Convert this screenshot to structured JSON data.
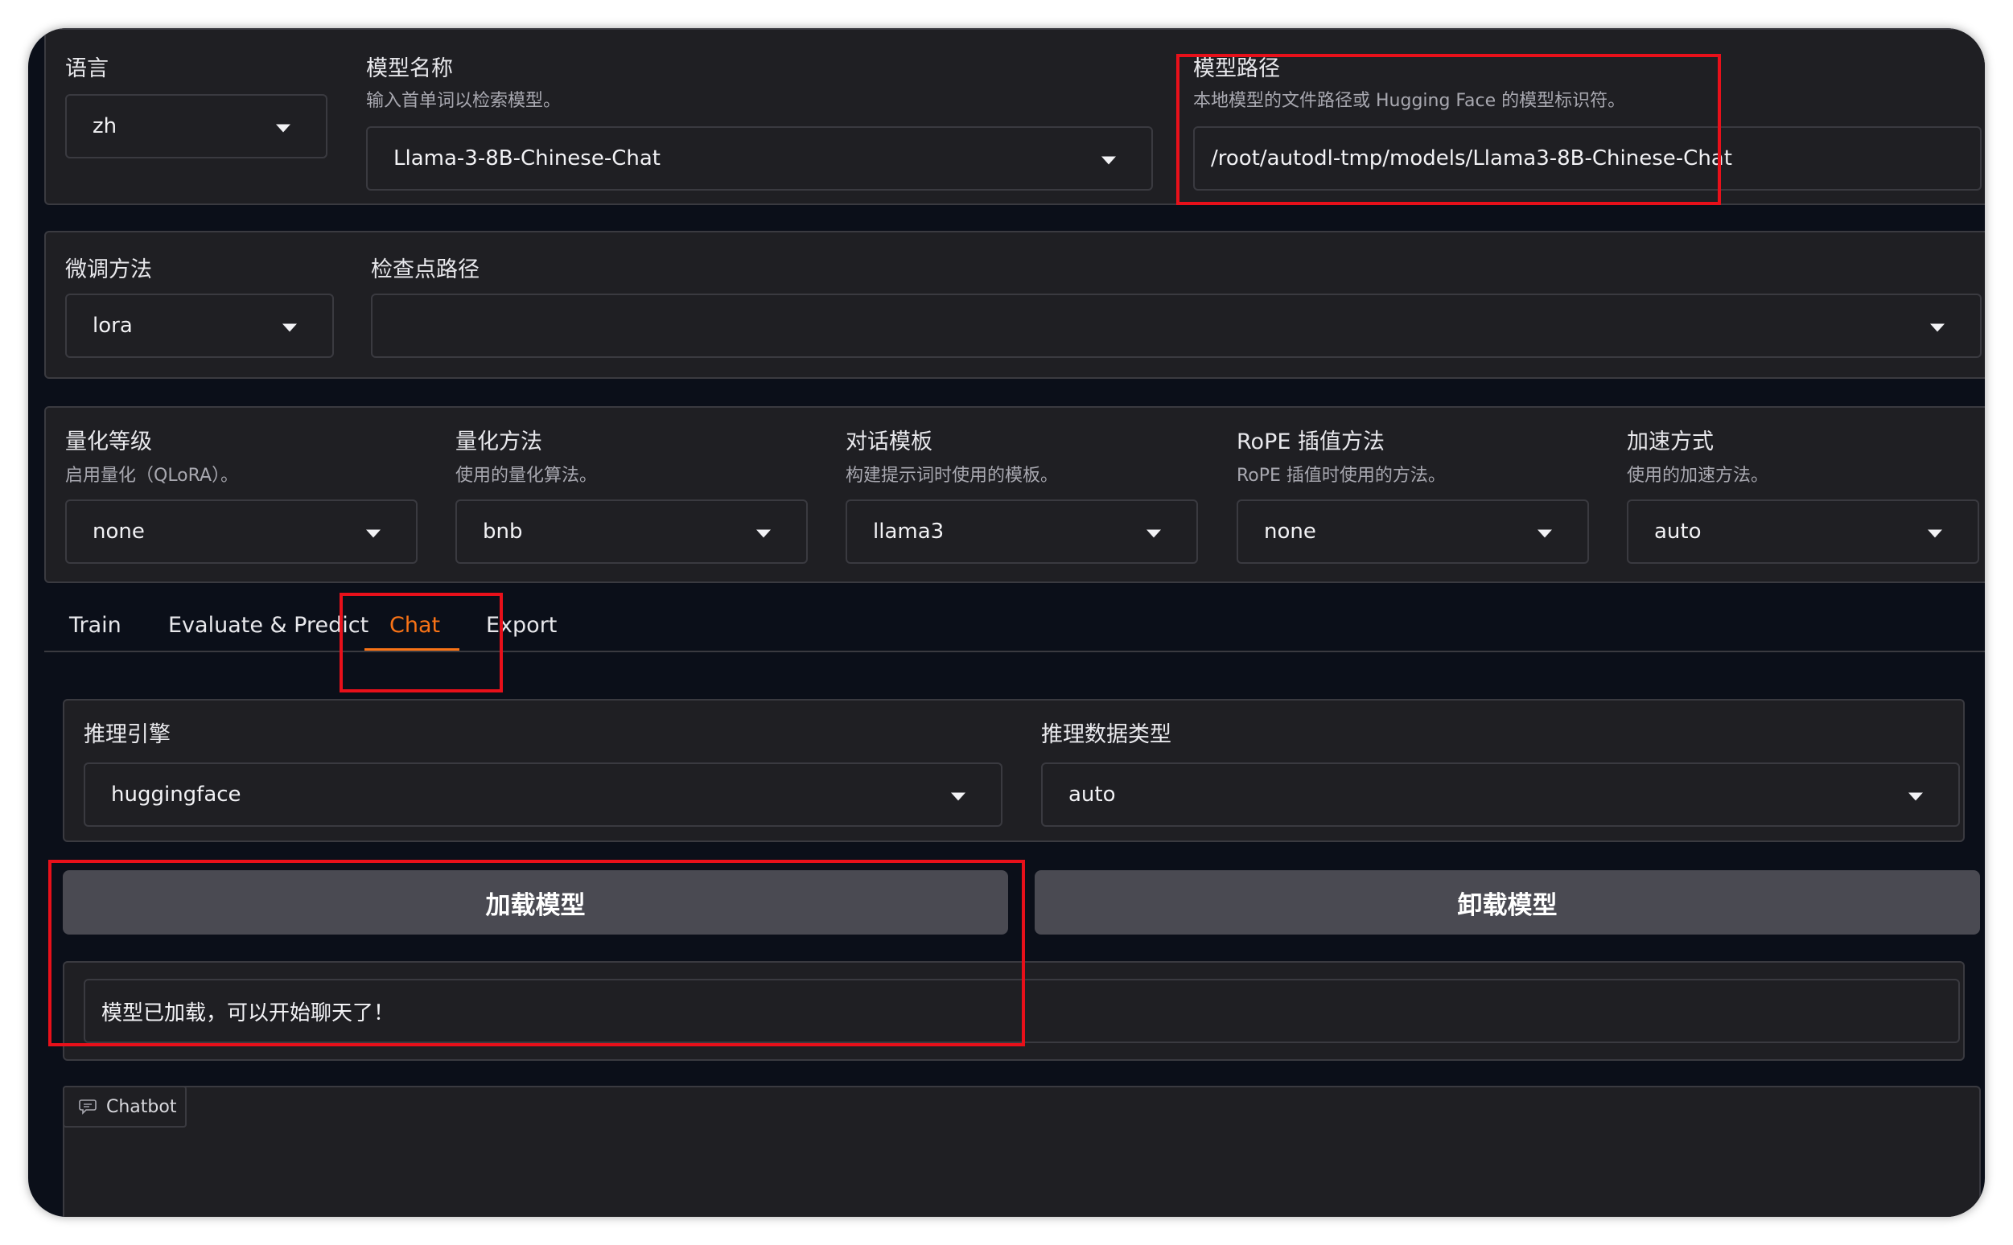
{
  "model_panel": {
    "language": {
      "label": "语言",
      "value": "zh"
    },
    "model_name": {
      "label": "模型名称",
      "info": "输入首单词以检索模型。",
      "value": "Llama-3-8B-Chinese-Chat"
    },
    "model_path": {
      "label": "模型路径",
      "info": "本地模型的文件路径或 Hugging Face 的模型标识符。",
      "value": "/root/autodl-tmp/models/Llama3-8B-Chinese-Chat"
    }
  },
  "finetune_panel": {
    "method": {
      "label": "微调方法",
      "value": "lora"
    },
    "checkpoint": {
      "label": "检查点路径",
      "value": ""
    }
  },
  "advanced_panel": {
    "quant_bit": {
      "label": "量化等级",
      "info": "启用量化（QLoRA）。",
      "value": "none"
    },
    "quant_method": {
      "label": "量化方法",
      "info": "使用的量化算法。",
      "value": "bnb"
    },
    "template": {
      "label": "对话模板",
      "info": "构建提示词时使用的模板。",
      "value": "llama3"
    },
    "rope": {
      "label": "RoPE 插值方法",
      "info": "RoPE 插值时使用的方法。",
      "value": "none"
    },
    "booster": {
      "label": "加速方式",
      "info": "使用的加速方法。",
      "value": "auto"
    }
  },
  "tabs": [
    {
      "label": "Train",
      "active": false
    },
    {
      "label": "Evaluate & Predict",
      "active": false
    },
    {
      "label": "Chat",
      "active": true
    },
    {
      "label": "Export",
      "active": false
    }
  ],
  "chat": {
    "infer_backend": {
      "label": "推理引擎",
      "value": "huggingface"
    },
    "infer_dtype": {
      "label": "推理数据类型",
      "value": "auto"
    },
    "load_button": "加载模型",
    "unload_button": "卸载模型",
    "status_text": "模型已加载，可以开始聊天了！",
    "chatbot_label": "Chatbot"
  },
  "colors": {
    "window_bg": "#0b0f19",
    "panel_bg": "#1f1f23",
    "accent": "#f97316",
    "button_bg": "#4a4a52",
    "highlight_box": "#e8101a"
  }
}
